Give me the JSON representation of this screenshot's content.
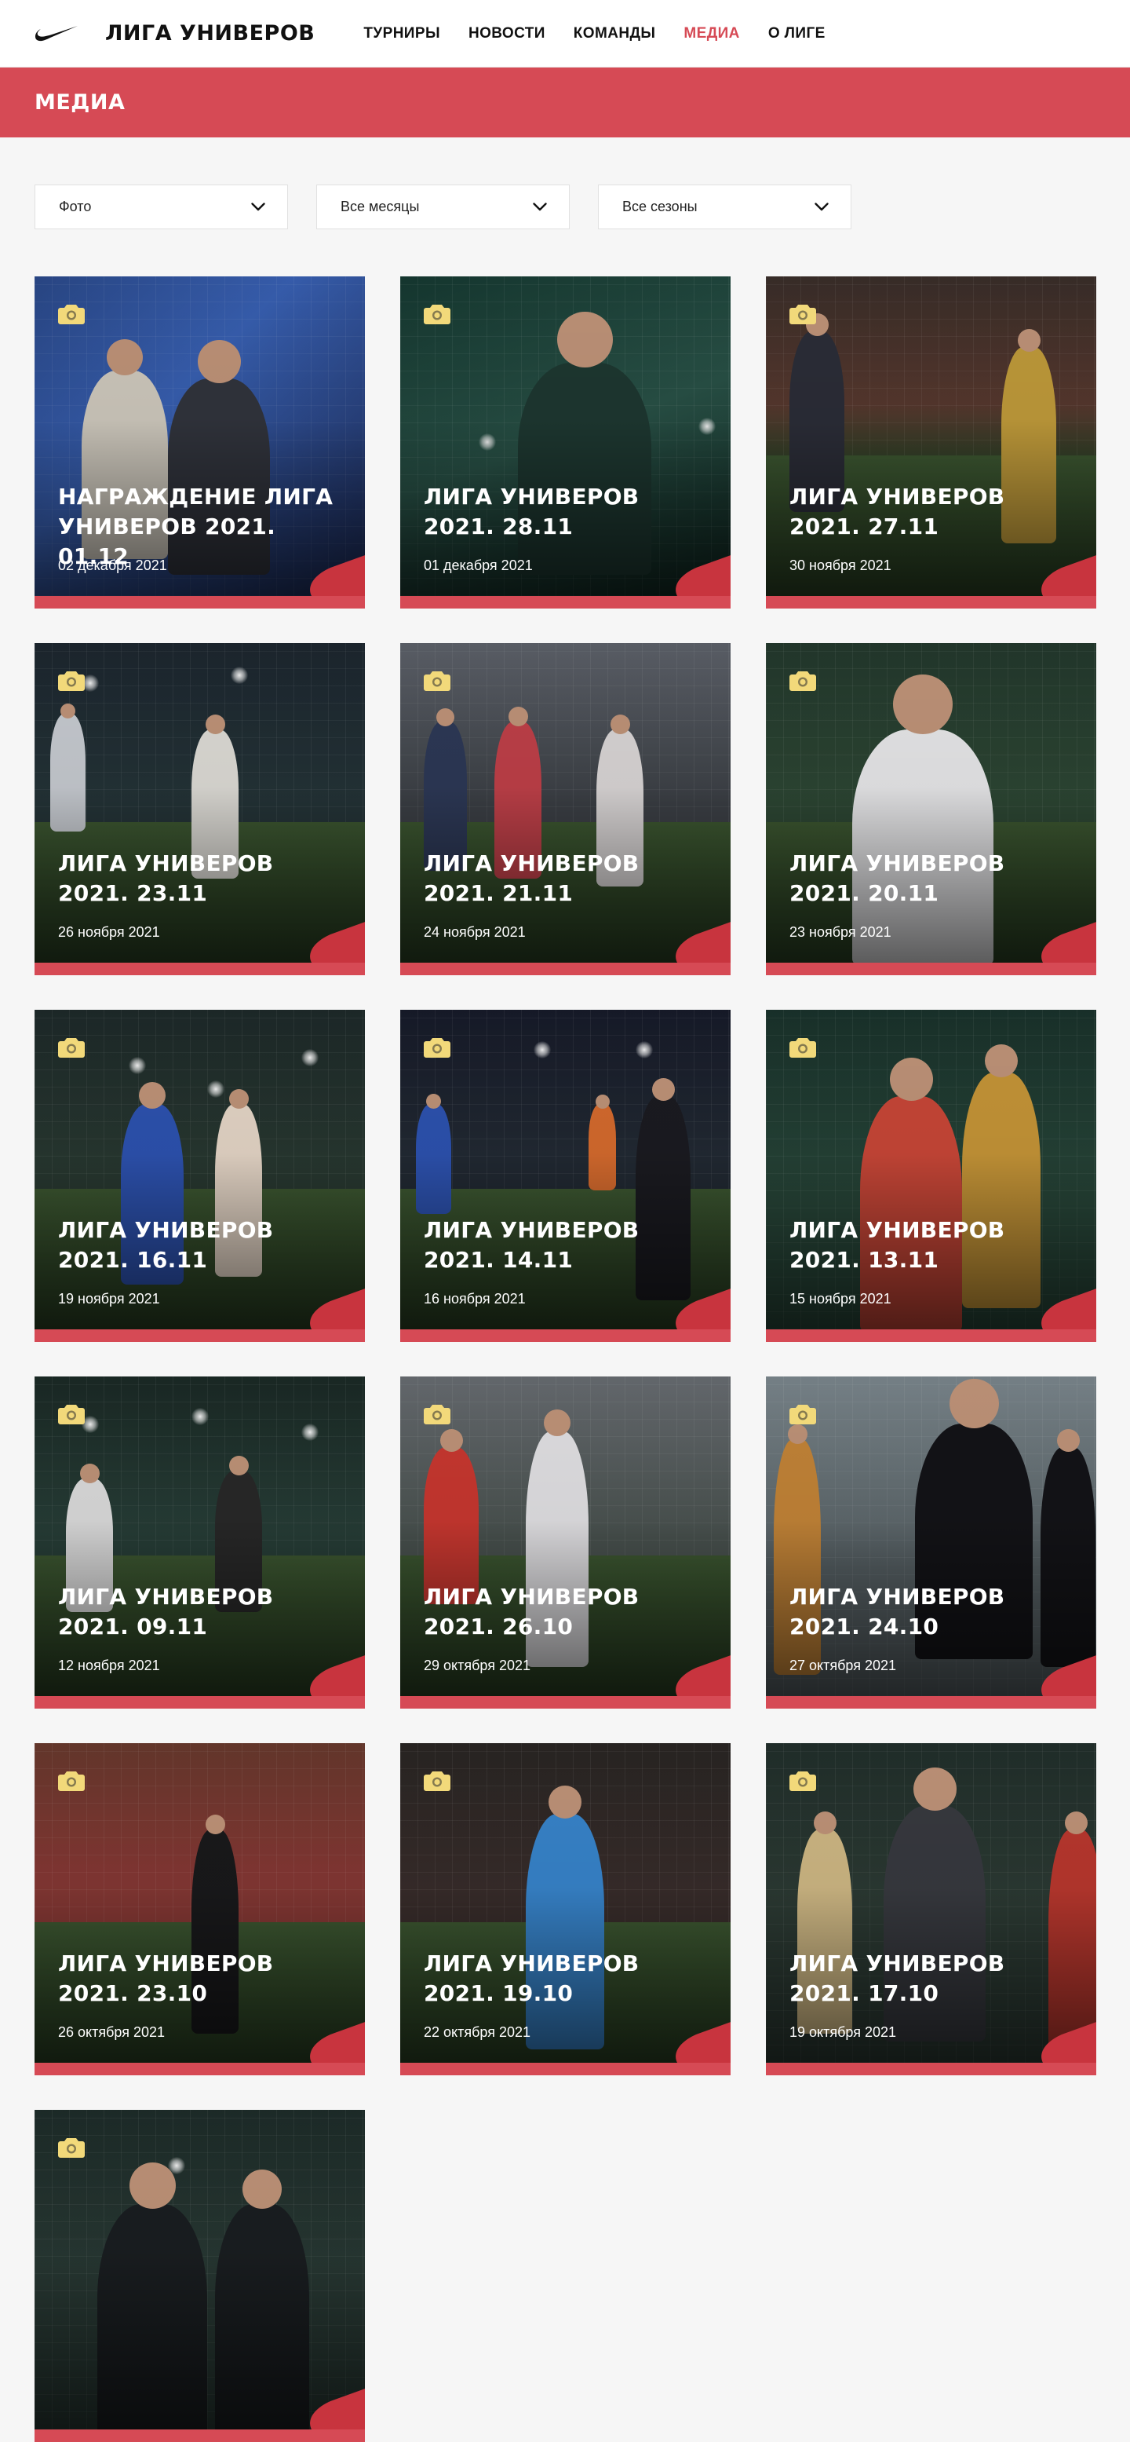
{
  "header": {
    "brand": "ЛИГА УНИВЕРОВ",
    "nav": [
      {
        "label": "ТУРНИРЫ",
        "active": false
      },
      {
        "label": "НОВОСТИ",
        "active": false
      },
      {
        "label": "КОМАНДЫ",
        "active": false
      },
      {
        "label": "МЕДИА",
        "active": true
      },
      {
        "label": "О ЛИГЕ",
        "active": false
      }
    ]
  },
  "section": {
    "title": "МЕДИА"
  },
  "filters": {
    "type": "Фото",
    "month": "Все месяцы",
    "season": "Все сезоны"
  },
  "colors": {
    "accent": "#d64a55",
    "camera_icon": "#f2d97a",
    "page_bg": "#f6f6f6"
  },
  "icons": {
    "logo": "swoosh-logo-icon",
    "filter": "chevron-down-icon",
    "card": "camera-icon"
  },
  "albums": [
    {
      "title": "НАГРАЖДЕНИЕ ЛИГА УНИВЕРОВ 2021. 01.12",
      "date": "02 декабря 2021"
    },
    {
      "title": "ЛИГА УНИВЕРОВ 2021. 28.11",
      "date": "01 декабря 2021"
    },
    {
      "title": "ЛИГА УНИВЕРОВ 2021. 27.11",
      "date": "30 ноября 2021"
    },
    {
      "title": "ЛИГА УНИВЕРОВ 2021. 23.11",
      "date": "26 ноября 2021"
    },
    {
      "title": "ЛИГА УНИВЕРОВ 2021. 21.11",
      "date": "24 ноября 2021"
    },
    {
      "title": "ЛИГА УНИВЕРОВ 2021. 20.11",
      "date": "23 ноября 2021"
    },
    {
      "title": "ЛИГА УНИВЕРОВ 2021. 16.11",
      "date": "19 ноября 2021"
    },
    {
      "title": "ЛИГА УНИВЕРОВ 2021. 14.11",
      "date": "16 ноября 2021"
    },
    {
      "title": "ЛИГА УНИВЕРОВ 2021. 13.11",
      "date": "15 ноября 2021"
    },
    {
      "title": "ЛИГА УНИВЕРОВ 2021. 09.11",
      "date": "12 ноября 2021"
    },
    {
      "title": "ЛИГА УНИВЕРОВ 2021. 26.10",
      "date": "29 октября 2021"
    },
    {
      "title": "ЛИГА УНИВЕРОВ 2021. 24.10",
      "date": "27 октября 2021"
    },
    {
      "title": "ЛИГА УНИВЕРОВ 2021. 23.10",
      "date": "26 октября 2021"
    },
    {
      "title": "ЛИГА УНИВЕРОВ 2021. 19.10",
      "date": "22 октября 2021"
    },
    {
      "title": "ЛИГА УНИВЕРОВ 2021. 17.10",
      "date": "19 октября 2021"
    },
    {
      "title": "",
      "date": ""
    }
  ]
}
